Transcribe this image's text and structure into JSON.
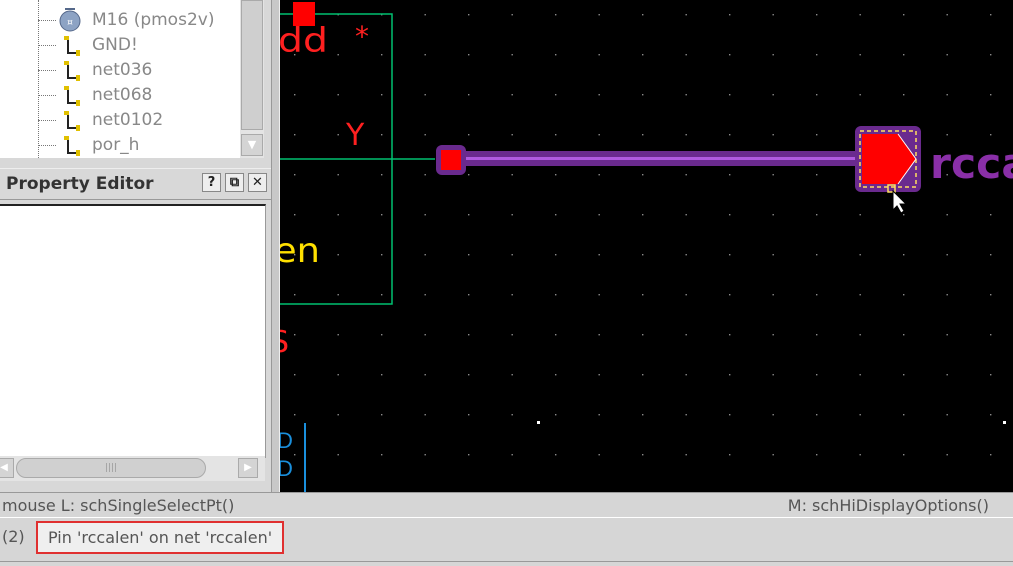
{
  "tree": {
    "items": [
      {
        "label": "M16 (pmos2v)",
        "icon": "transistor-icon"
      },
      {
        "label": "GND!",
        "icon": "net-icon"
      },
      {
        "label": "net036",
        "icon": "net-icon"
      },
      {
        "label": "net068",
        "icon": "net-icon"
      },
      {
        "label": "net0102",
        "icon": "net-icon"
      },
      {
        "label": "por_h",
        "icon": "net-icon"
      }
    ]
  },
  "property_editor": {
    "title": "Property Editor",
    "help_btn": "?",
    "float_btn": "⧉",
    "close_btn": "✕"
  },
  "canvas": {
    "labels": {
      "vdd_partial": "dd",
      "asterisk": "*",
      "y": "Y",
      "en_partial": "en",
      "s_partial": "S",
      "pin_name_partial": "rcca"
    },
    "colors": {
      "background": "#000000",
      "symbol_outline": "#00d070",
      "wire": "#8a1fb0",
      "highlight": "#7a2fa0",
      "pin_fill": "#ff0000",
      "instance_text": "#ff2020",
      "pin_text": "#ffe000",
      "pin_name_text": "#8a2fa8"
    }
  },
  "status": {
    "mouse_left": "mouse L: schSingleSelectPt()",
    "mouse_middle": "M: schHiDisplayOptions()"
  },
  "prompt": {
    "count": "(2)",
    "message": "Pin 'rccalen' on net 'rccalen'"
  }
}
